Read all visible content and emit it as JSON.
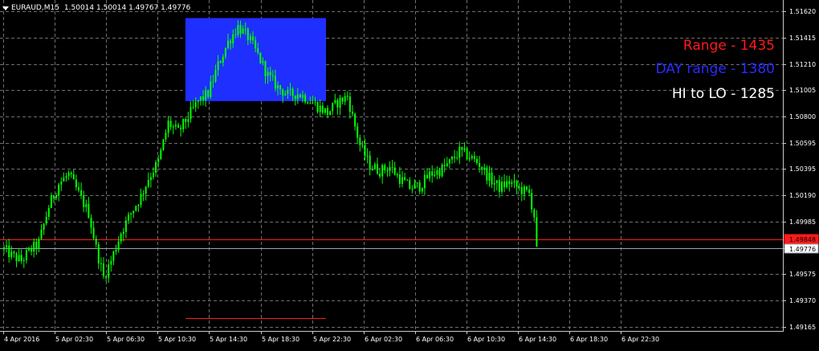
{
  "header": {
    "symbol": "EURAUD,M15",
    "ohlc": "1.50014 1.50014 1.49767 1.49776"
  },
  "overlays": {
    "range": "Range - 1435",
    "day_range": "DAY range - 1380",
    "hi_lo": "HI to LO - 1285"
  },
  "colors": {
    "background": "#000000",
    "grid": "#6e6e6e",
    "candles": "#00ff00",
    "range_box": "#1f2fff",
    "red_line": "#ff1a1a",
    "bid_line": "#9aa3b5",
    "axis_text": "#ffffff",
    "range_text": "#ff1a1a",
    "day_range_text": "#2a2aff",
    "hilo_text": "#ffffff"
  },
  "price_axis": {
    "ticks": [
      "1.51620",
      "1.51415",
      "1.51210",
      "1.51005",
      "1.50800",
      "1.50595",
      "1.50395",
      "1.50190",
      "1.49985",
      "1.49780",
      "1.49575",
      "1.49370",
      "1.49165"
    ],
    "labels": [
      {
        "id": "red-level-label",
        "text": "1.49848",
        "price": 1.49848
      },
      {
        "id": "bid-level-label",
        "text": "1.49776",
        "price": 1.49776
      }
    ]
  },
  "time_axis": {
    "labels": [
      "4 Apr 2016",
      "5 Apr 02:30",
      "5 Apr 06:30",
      "5 Apr 10:30",
      "5 Apr 14:30",
      "5 Apr 18:30",
      "5 Apr 22:30",
      "6 Apr 02:30",
      "6 Apr 06:30",
      "6 Apr 10:30",
      "6 Apr 14:30",
      "6 Apr 18:30",
      "6 Apr 22:30"
    ]
  },
  "chart_data": {
    "type": "candlestick",
    "symbol": "EURAUD",
    "timeframe": "M15",
    "ylim": [
      1.49165,
      1.5162
    ],
    "levels": [
      {
        "name": "red-level",
        "price": 1.49848
      },
      {
        "name": "bid-level",
        "price": 1.49776
      }
    ],
    "range_box": {
      "from": "5 Apr 10:30",
      "to": "5 Apr 22:30",
      "high": 1.51567,
      "low": 1.50921
    },
    "range_low_line_price": 1.49235,
    "price_path": [
      [
        0,
        1.4977
      ],
      [
        3,
        1.4972
      ],
      [
        7,
        1.4968
      ],
      [
        10,
        1.4975
      ],
      [
        14,
        1.4982
      ],
      [
        18,
        1.501
      ],
      [
        22,
        1.5028
      ],
      [
        26,
        1.5035
      ],
      [
        30,
        1.502
      ],
      [
        34,
        1.5005
      ],
      [
        37,
        1.4978
      ],
      [
        40,
        1.4955
      ],
      [
        43,
        1.4968
      ],
      [
        47,
        1.499
      ],
      [
        51,
        1.5005
      ],
      [
        55,
        1.5018
      ],
      [
        58,
        1.5032
      ],
      [
        62,
        1.5045
      ],
      [
        66,
        1.5075
      ],
      [
        70,
        1.5068
      ],
      [
        74,
        1.508
      ],
      [
        78,
        1.5092
      ],
      [
        82,
        1.5098
      ],
      [
        86,
        1.512
      ],
      [
        90,
        1.5138
      ],
      [
        94,
        1.515
      ],
      [
        98,
        1.5142
      ],
      [
        102,
        1.5128
      ],
      [
        106,
        1.5112
      ],
      [
        110,
        1.5103
      ],
      [
        114,
        1.5097
      ],
      [
        118,
        1.5098
      ],
      [
        122,
        1.5094
      ],
      [
        126,
        1.5088
      ],
      [
        130,
        1.5083
      ],
      [
        134,
        1.5091
      ],
      [
        138,
        1.5096
      ],
      [
        140,
        1.508
      ],
      [
        143,
        1.5058
      ],
      [
        147,
        1.5042
      ],
      [
        151,
        1.5038
      ],
      [
        155,
        1.5041
      ],
      [
        159,
        1.5032
      ],
      [
        163,
        1.5025
      ],
      [
        167,
        1.5026
      ],
      [
        171,
        1.5035
      ],
      [
        175,
        1.5038
      ],
      [
        179,
        1.5044
      ],
      [
        183,
        1.5053
      ],
      [
        187,
        1.5049
      ],
      [
        191,
        1.5043
      ],
      [
        195,
        1.5032
      ],
      [
        199,
        1.5025
      ],
      [
        203,
        1.5029
      ],
      [
        207,
        1.5024
      ],
      [
        211,
        1.502
      ],
      [
        213,
        1.5003
      ],
      [
        214,
        1.4979
      ]
    ]
  }
}
